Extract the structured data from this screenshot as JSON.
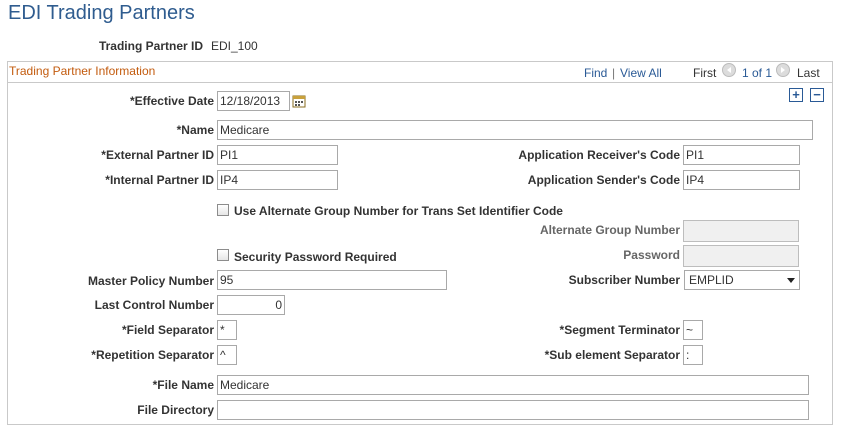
{
  "page_title": "EDI Trading Partners",
  "trading_partner_id_label": "Trading Partner ID",
  "trading_partner_id_value": "EDI_100",
  "panel": {
    "title": "Trading Partner Information",
    "find": "Find",
    "divider": "|",
    "view_all": "View All",
    "first": "First",
    "range": "1 of 1",
    "last": "Last"
  },
  "form": {
    "effective_date_label": "*Effective Date",
    "effective_date": "12/18/2013",
    "name_label": "*Name",
    "name": "Medicare",
    "external_partner_id_label": "*External Partner ID",
    "external_partner_id": "PI1",
    "internal_partner_id_label": "*Internal Partner ID",
    "internal_partner_id": "IP4",
    "app_receiver_label": "Application Receiver's Code",
    "app_receiver": "PI1",
    "app_sender_label": "Application Sender's Code",
    "app_sender": "IP4",
    "alt_group_checkbox_label": "Use Alternate Group Number for Trans Set Identifier Code",
    "alt_group_number_label": "Alternate Group Number",
    "alt_group_number": "",
    "security_password_label": "Security Password Required",
    "password_label": "Password",
    "password": "",
    "master_policy_label": "Master Policy Number",
    "master_policy": "95",
    "subscriber_number_label": "Subscriber Number",
    "subscriber_number": "EMPLID",
    "last_control_label": "Last Control Number",
    "last_control": "0",
    "field_separator_label": "*Field Separator",
    "field_separator": "*",
    "segment_terminator_label": "*Segment Terminator",
    "segment_terminator": "~",
    "repetition_separator_label": "*Repetition Separator",
    "repetition_separator": "^",
    "sub_element_label": "*Sub element Separator",
    "sub_element": ":",
    "file_name_label": "*File Name",
    "file_name": "Medicare",
    "file_directory_label": "File Directory",
    "file_directory": ""
  }
}
